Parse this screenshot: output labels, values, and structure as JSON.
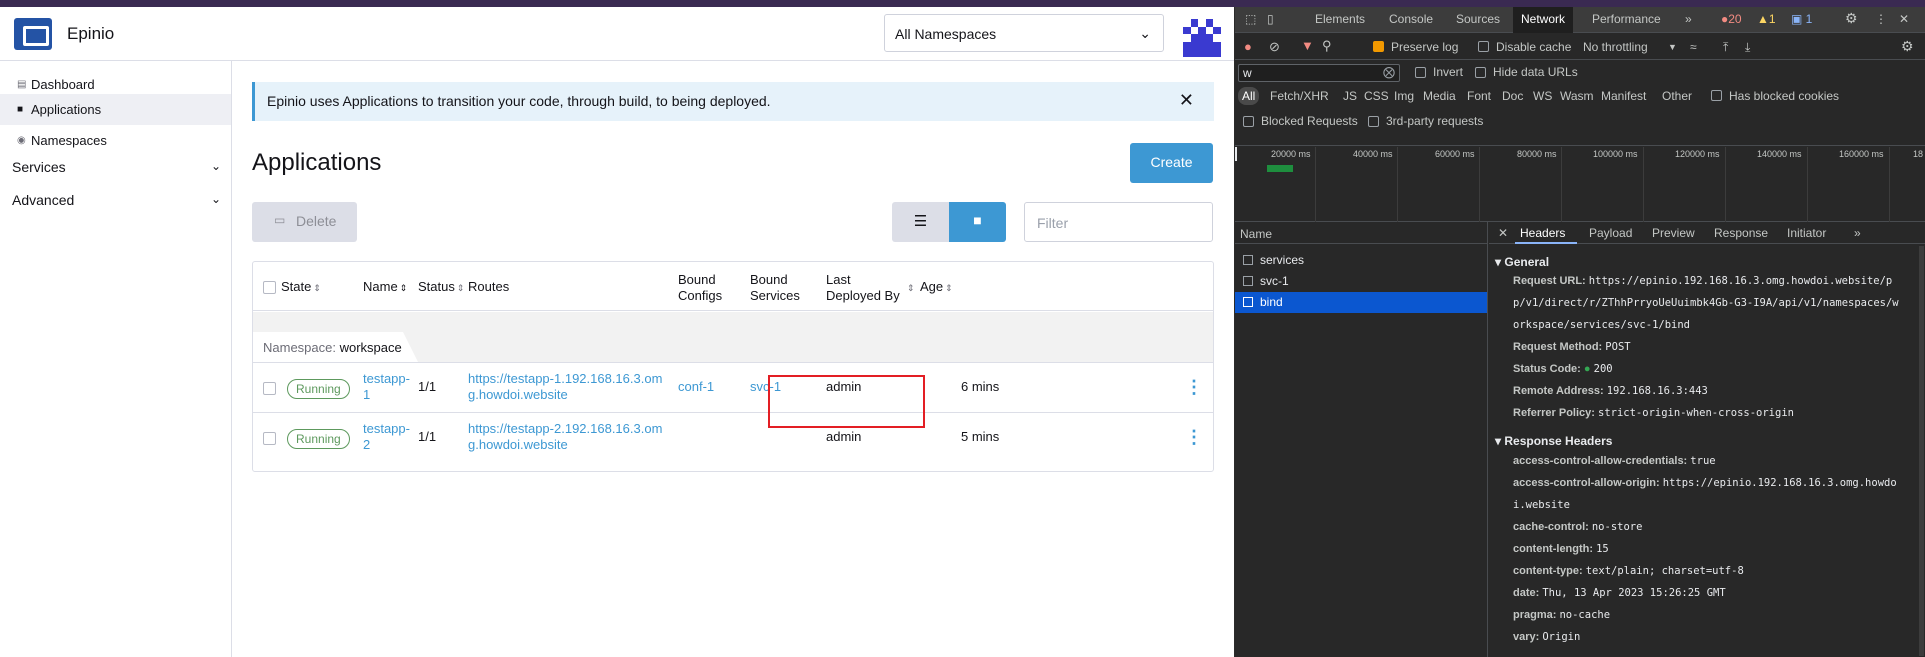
{
  "app": {
    "name": "Epinio",
    "namespace_selector": "All Namespaces",
    "nav": {
      "items": [
        "Dashboard",
        "Applications",
        "Namespaces"
      ],
      "groups": [
        "Services",
        "Advanced"
      ]
    },
    "banner": "Epinio uses Applications to transition your code, through build, to being deployed.",
    "title": "Applications",
    "create_label": "Create",
    "delete_label": "Delete",
    "filter_placeholder": "Filter",
    "table": {
      "columns": {
        "state": "State",
        "name": "Name",
        "status": "Status",
        "routes": "Routes",
        "bound_configs": "Bound Configs",
        "bound_services": "Bound Services",
        "last_deployed_by": "Last Deployed By",
        "age": "Age"
      },
      "group_label": "Namespace:",
      "group_value": "workspace",
      "rows": [
        {
          "state": "Running",
          "name": "testapp-1",
          "status": "1/1",
          "route": "https://testapp-1.192.168.16.3.omg.howdoi.website",
          "config": "conf-1",
          "service": "svc-1",
          "deployed_by": "admin",
          "age": "6 mins"
        },
        {
          "state": "Running",
          "name": "testapp-2",
          "status": "1/1",
          "route": "https://testapp-2.192.168.16.3.omg.howdoi.website",
          "config": "",
          "service": "",
          "deployed_by": "admin",
          "age": "5 mins"
        }
      ]
    }
  },
  "devtools": {
    "tabs": [
      "Elements",
      "Console",
      "Sources",
      "Network",
      "Performance"
    ],
    "active_tab": "Network",
    "counts": {
      "errors": "20",
      "warnings": "1",
      "info": "1"
    },
    "toolbar": {
      "preserve_log": "Preserve log",
      "disable_cache": "Disable cache",
      "throttling": "No throttling"
    },
    "filter": {
      "value": "w",
      "invert": "Invert",
      "hide_data_urls": "Hide data URLs",
      "types": [
        "All",
        "Fetch/XHR",
        "JS",
        "CSS",
        "Img",
        "Media",
        "Font",
        "Doc",
        "WS",
        "Wasm",
        "Manifest",
        "Other"
      ],
      "has_blocked_cookies": "Has blocked cookies",
      "blocked_requests": "Blocked Requests",
      "third_party": "3rd-party requests"
    },
    "timeline_ticks": [
      "20000 ms",
      "40000 ms",
      "60000 ms",
      "80000 ms",
      "100000 ms",
      "120000 ms",
      "140000 ms",
      "160000 ms",
      "18"
    ],
    "name_header": "Name",
    "requests": [
      "services",
      "svc-1",
      "bind"
    ],
    "selected_request": "bind",
    "detail_tabs": [
      "Headers",
      "Payload",
      "Preview",
      "Response",
      "Initiator"
    ],
    "general_title": "General",
    "general": [
      {
        "k": "Request URL:",
        "v": "https://epinio.192.168.16.3.omg.howdoi.website/pp/v1/direct/r/ZThhPrryoUeUuimbk4Gb-G3-I9A/api/v1/namespaces/workspace/services/svc-1/bind"
      },
      {
        "k": "Request Method:",
        "v": "POST"
      },
      {
        "k": "Status Code:",
        "v": "200"
      },
      {
        "k": "Remote Address:",
        "v": "192.168.16.3:443"
      },
      {
        "k": "Referrer Policy:",
        "v": "strict-origin-when-cross-origin"
      }
    ],
    "response_headers_title": "Response Headers",
    "response_headers": [
      {
        "k": "access-control-allow-credentials:",
        "v": "true"
      },
      {
        "k": "access-control-allow-origin:",
        "v": "https://epinio.192.168.16.3.omg.howdoi.website"
      },
      {
        "k": "cache-control:",
        "v": "no-store"
      },
      {
        "k": "content-length:",
        "v": "15"
      },
      {
        "k": "content-type:",
        "v": "text/plain; charset=utf-8"
      },
      {
        "k": "date:",
        "v": "Thu, 13 Apr 2023 15:26:25 GMT"
      },
      {
        "k": "pragma:",
        "v": "no-cache"
      },
      {
        "k": "vary:",
        "v": "Origin"
      }
    ]
  },
  "colors": {
    "accent": "#3d98d3",
    "running": "#5d995d",
    "highlight": "#e31e24",
    "devtools_selected": "#0b57d0"
  }
}
